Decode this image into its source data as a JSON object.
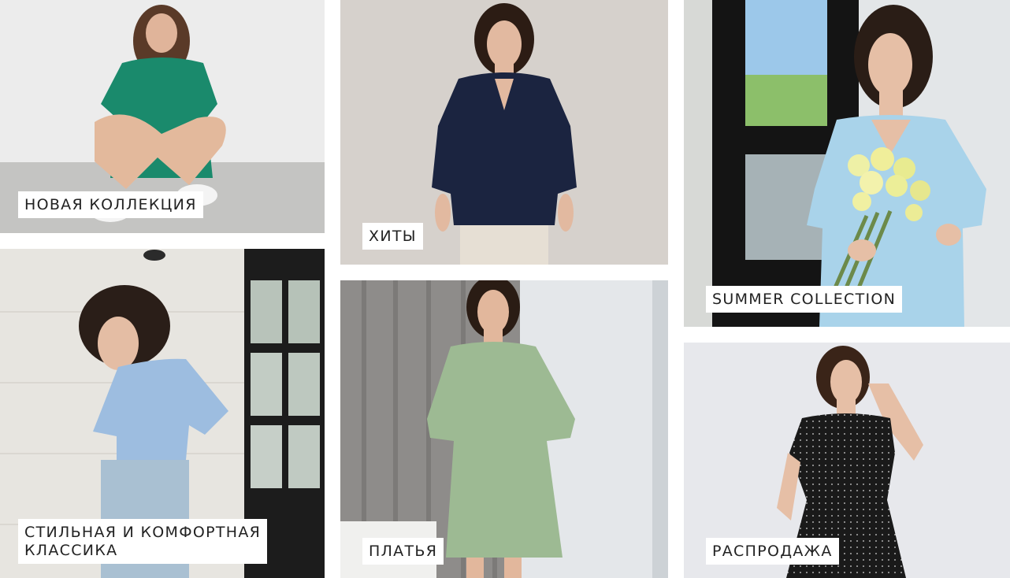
{
  "tiles": [
    {
      "id": "new-collection",
      "label": "НОВАЯ КОЛЛЕКЦИЯ"
    },
    {
      "id": "hits",
      "label": "ХИТЫ"
    },
    {
      "id": "summer-collection",
      "label": "SUMMER COLLECTION"
    },
    {
      "id": "stylish-classic",
      "label": "СТИЛЬНАЯ И КОМФОРТНАЯ\nКЛАССИКА"
    },
    {
      "id": "dresses",
      "label": "ПЛАТЬЯ"
    },
    {
      "id": "sale",
      "label": "РАСПРОДАЖА"
    }
  ],
  "colors": {
    "background": "#ffffff",
    "label_background": "#ffffff",
    "label_text": "#222222",
    "green_dress": "#1a8a6c",
    "navy_blouse": "#1b2440",
    "light_blue_dress": "#a9d3ea",
    "sky_blue_top": "#9dbde0",
    "sage_dress": "#9dba93",
    "black_dot_dress": "#1a1a1a"
  }
}
